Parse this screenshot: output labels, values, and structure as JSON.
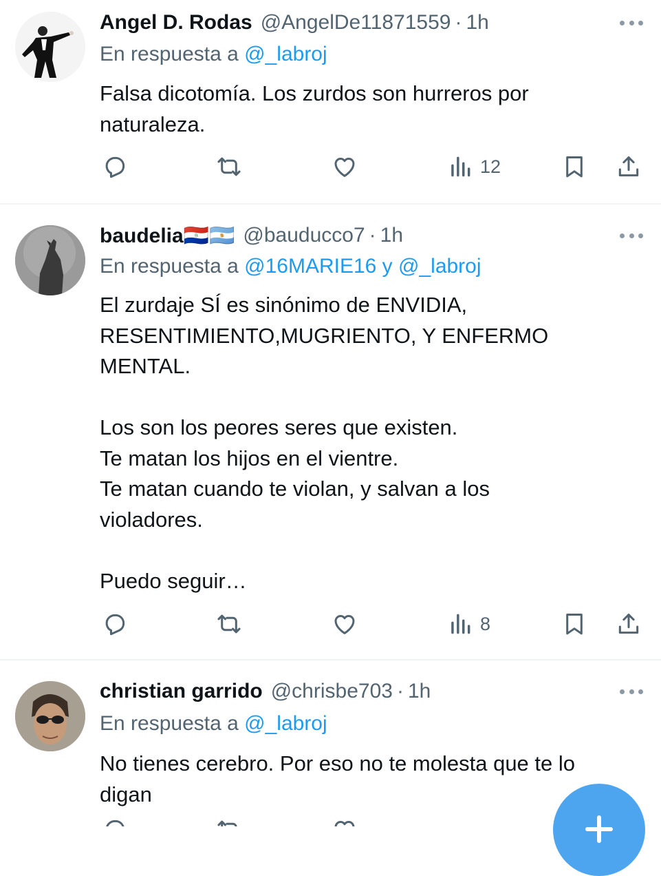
{
  "tweets": [
    {
      "name": "Angel D. Rodas",
      "handle": "@AngelDe11871559",
      "dot": "·",
      "time": "1h",
      "reply_prefix": "En respuesta a ",
      "reply_mentions": "@_labroj",
      "text": "Falsa dicotomía. Los zurdos son hurreros por\nnaturaleza.",
      "views": "12",
      "avatar_icon": "man-in-tuxedo-avatar"
    },
    {
      "name": "baudelia🇵🇾🇦🇷",
      "handle": "@bauducco7",
      "dot": "·",
      "time": "1h",
      "reply_prefix": "En respuesta a ",
      "reply_mentions": "@16MARIE16 y @_labroj",
      "text": "El zurdaje SÍ es sinónimo de ENVIDIA,\nRESENTIMIENTO,MUGRIENTO, Y ENFERMO\nMENTAL.\n\nLos son los peores seres que existen.\nTe matan los hijos en el vientre.\nTe matan cuando te violan, y salvan a los\nvioladores.\n\nPuedo seguir…",
      "views": "8",
      "avatar_icon": "howling-wolf-avatar"
    },
    {
      "name": "christian garrido",
      "handle": "@chrisbe703",
      "dot": "·",
      "time": "1h",
      "reply_prefix": "En respuesta a ",
      "reply_mentions": "@_labroj",
      "text": "No tienes cerebro. Por eso no te molesta que te lo\ndigan",
      "avatar_icon": "man-with-sunglasses-avatar"
    }
  ],
  "icons": {
    "reply": "reply-icon",
    "retweet": "retweet-icon",
    "like": "heart-icon",
    "views": "views-chart-icon",
    "bookmark": "bookmark-icon",
    "share": "share-icon",
    "more": "more-dots-icon",
    "compose": "compose-plus-icon"
  },
  "colors": {
    "text": "#0f1419",
    "secondary": "#536471",
    "link": "#1d9bf0",
    "icon": "#536471",
    "divider": "#eff3f4",
    "fab": "#4ea5ef"
  }
}
